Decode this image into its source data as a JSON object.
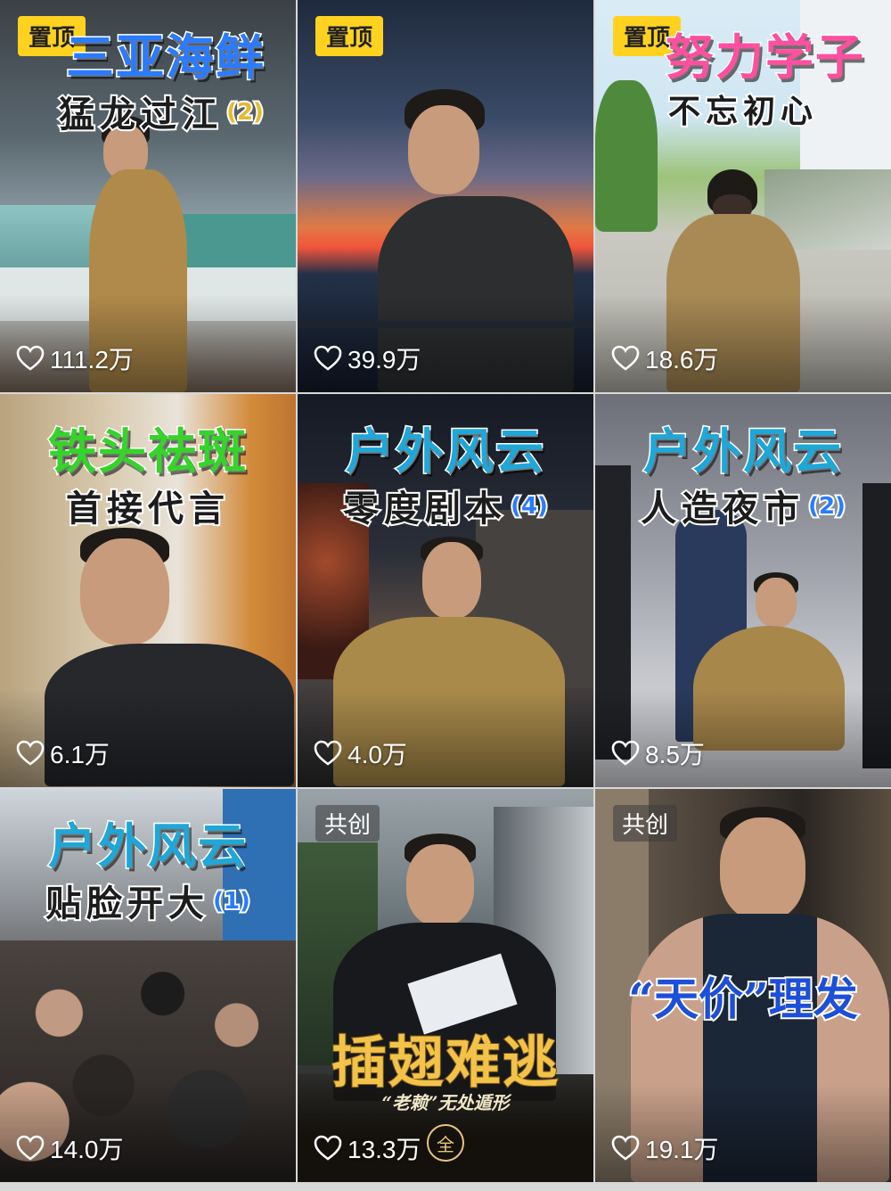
{
  "tiles": [
    {
      "badge": "置顶",
      "title": "三亚海鲜",
      "subtitle": "猛龙过江",
      "episode": "(2)",
      "likes": "111.2万"
    },
    {
      "badge": "置顶",
      "title": "",
      "subtitle": "",
      "episode": "",
      "likes": "39.9万"
    },
    {
      "badge": "置顶",
      "title": "努力学子",
      "subtitle": "不忘初心",
      "episode": "",
      "likes": "18.6万"
    },
    {
      "badge": "",
      "title": "铁头祛斑",
      "subtitle": "首接代言",
      "episode": "",
      "likes": "6.1万"
    },
    {
      "badge": "",
      "title": "户外风云",
      "subtitle": "零度剧本",
      "episode": "(4)",
      "likes": "4.0万"
    },
    {
      "badge": "",
      "title": "户外风云",
      "subtitle": "人造夜市",
      "episode": "(2)",
      "likes": "8.5万"
    },
    {
      "badge": "",
      "title": "户外风云",
      "subtitle": "贴脸开大",
      "episode": "(1)",
      "likes": "14.0万"
    },
    {
      "badge": "共创",
      "title": "插翅难逃",
      "subtitle": "“老赖”无处遁形",
      "episode": "全",
      "likes": "13.3万"
    },
    {
      "badge": "共创",
      "title": "“天价”理发",
      "subtitle": "",
      "episode": "",
      "likes": "19.1万"
    }
  ],
  "colors": {
    "pin_badge": "#ffd21f",
    "title_blue": "#2a7bff",
    "title_pink": "#ff4fa0",
    "title_green": "#36d42a",
    "title_cyan": "#1ea7d8",
    "title_gold": "#f3c24a"
  },
  "icons": {
    "likes": "heart-outline-icon"
  }
}
